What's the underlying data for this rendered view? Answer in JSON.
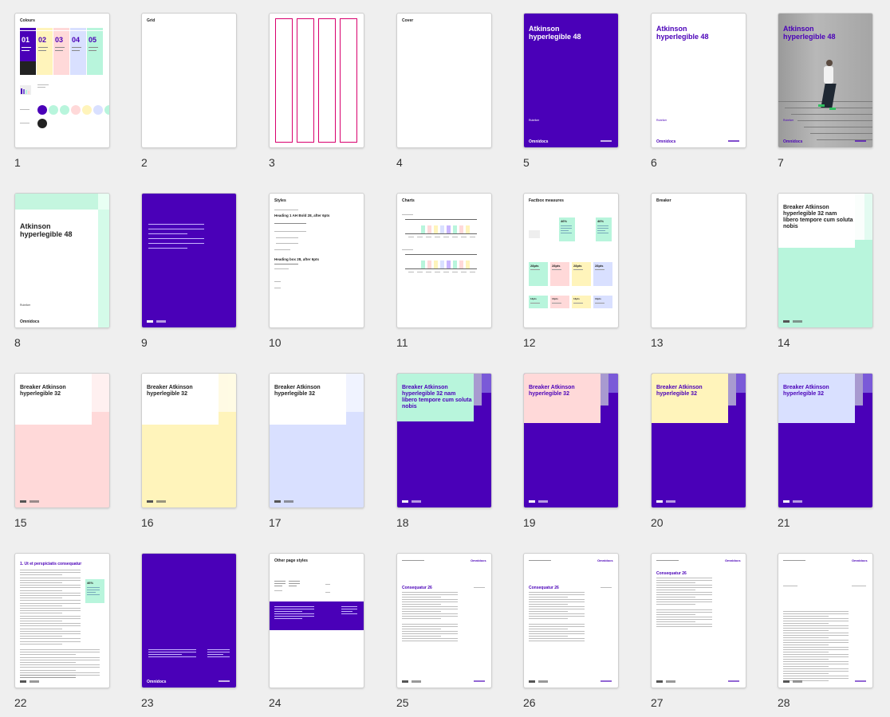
{
  "colors": {
    "purple": "#4a00b8",
    "mint": "#b8f5dc",
    "pink": "#ffd9d9",
    "yellow": "#fff4bb",
    "blue": "#d9e0ff",
    "magenta": "#d8006e"
  },
  "pages": [
    {
      "num": "1",
      "title": "Colours",
      "swatches": [
        "01",
        "02",
        "03",
        "04",
        "05"
      ]
    },
    {
      "num": "2",
      "title": "Grid"
    },
    {
      "num": "3"
    },
    {
      "num": "4",
      "title": "Cover"
    },
    {
      "num": "5",
      "heading": "Atkinson hyperlegible 48",
      "sub": "Rubriker",
      "brand": "Omnidocs"
    },
    {
      "num": "6",
      "heading": "Atkinson hyperlegible 48",
      "sub": "Rubriker",
      "brand": "Omnidocs"
    },
    {
      "num": "7",
      "heading": "Atkinson hyperlegible 48",
      "sub": "Rubriker",
      "brand": "Omnidocs"
    },
    {
      "num": "8",
      "heading": "Atkinson hyperlegible 48",
      "sub": "Rubriker",
      "brand": "Omnidocs"
    },
    {
      "num": "9"
    },
    {
      "num": "10",
      "title": "Styles",
      "h1": "Heading 1 AH Bold 28, after 6pts",
      "h2": "Heading box 28, after 6pts"
    },
    {
      "num": "11",
      "title": "Charts"
    },
    {
      "num": "12",
      "title": "Factbox measures",
      "stat": "46%",
      "cells": [
        "28pts",
        "28pts",
        "28pts",
        "28pts",
        "14pts",
        "14pts",
        "14pts",
        "14pts"
      ]
    },
    {
      "num": "13",
      "title": "Breaker"
    },
    {
      "num": "14",
      "heading": "Breaker Atkinson hyperlegible 32 nam libero tempore cum soluta nobis"
    },
    {
      "num": "15",
      "heading": "Breaker Atkinson hyperlegible 32"
    },
    {
      "num": "16",
      "heading": "Breaker Atkinson hyperlegible 32"
    },
    {
      "num": "17",
      "heading": "Breaker Atkinson hyperlegible 32"
    },
    {
      "num": "18",
      "heading": "Breaker Atkinson hyperlegible 32 nam libero tempore cum soluta nobis"
    },
    {
      "num": "19",
      "heading": "Breaker Atkinson hyperlegible 32"
    },
    {
      "num": "20",
      "heading": "Breaker Atkinson hyperlegible 32"
    },
    {
      "num": "21",
      "heading": "Breaker Atkinson hyperlegible 32"
    },
    {
      "num": "22",
      "heading": "1. Ut et perspiciatis consequatur",
      "stat": "46%"
    },
    {
      "num": "23",
      "brand": "Omnidocs"
    },
    {
      "num": "24",
      "title": "Other page styles"
    },
    {
      "num": "25",
      "heading": "Consequatur 26",
      "brand": "Omnidocs"
    },
    {
      "num": "26",
      "heading": "Consequatur 26",
      "brand": "Omnidocs"
    },
    {
      "num": "27",
      "heading": "Consequatur 26",
      "brand": "Omnidocs"
    },
    {
      "num": "28",
      "brand": "Omnidocs"
    }
  ]
}
